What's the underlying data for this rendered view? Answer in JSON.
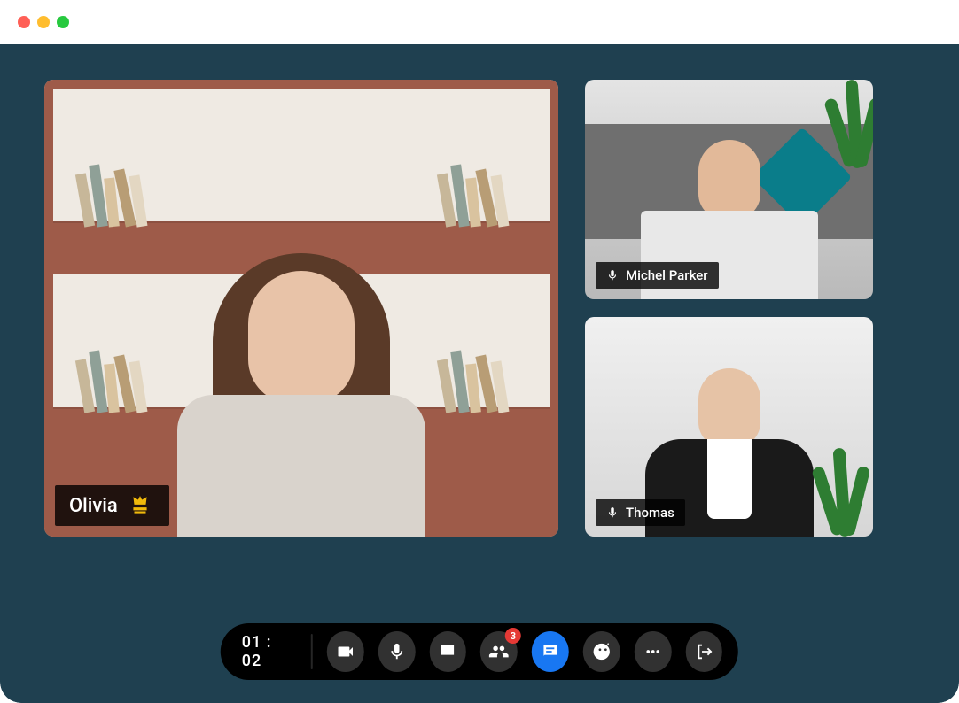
{
  "participants": {
    "main": {
      "name": "Olivia",
      "is_host": true
    },
    "side": [
      {
        "name": "Michel Parker",
        "mic_on": true
      },
      {
        "name": "Thomas",
        "mic_on": true
      }
    ]
  },
  "toolbar": {
    "timer": "01 : 02",
    "participants_badge": "3",
    "buttons": {
      "camera": "camera",
      "mic": "microphone",
      "share": "share-screen",
      "participants": "participants",
      "chat": "chat",
      "raise_hand": "raise-hand",
      "more": "more",
      "leave": "leave"
    }
  },
  "colors": {
    "stage": "#1f4050",
    "accent": "#1877f2",
    "badge": "#e53935",
    "host_crown": "#f0b90b"
  }
}
